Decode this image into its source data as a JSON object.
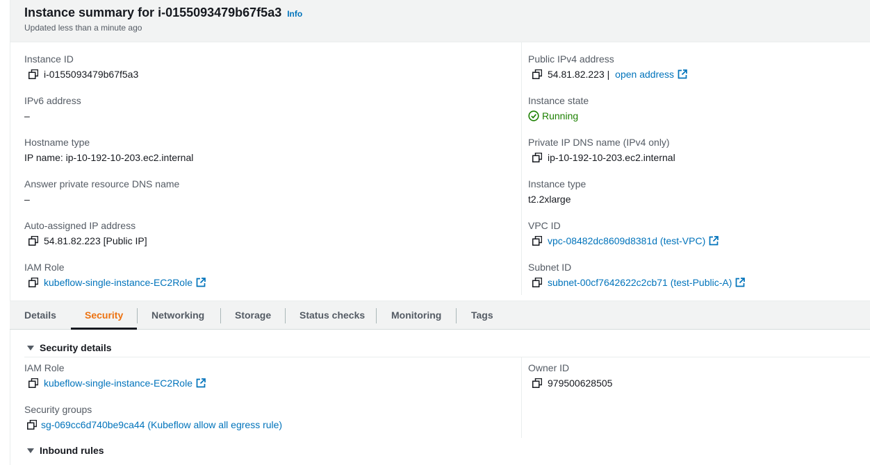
{
  "header": {
    "title": "Instance summary for i-0155093479b67f5a3",
    "info_label": "Info",
    "updated": "Updated less than a minute ago"
  },
  "summary": {
    "left": {
      "instance_id": {
        "label": "Instance ID",
        "value": "i-0155093479b67f5a3"
      },
      "ipv6": {
        "label": "IPv6 address",
        "value": "–"
      },
      "hostname_type": {
        "label": "Hostname type",
        "value": "IP name: ip-10-192-10-203.ec2.internal"
      },
      "answer_dns": {
        "label": "Answer private resource DNS name",
        "value": "–"
      },
      "auto_ip": {
        "label": "Auto-assigned IP address",
        "value": "54.81.82.223 [Public IP]"
      },
      "iam_role": {
        "label": "IAM Role",
        "value": "kubeflow-single-instance-EC2Role"
      }
    },
    "right": {
      "public_ipv4": {
        "label": "Public IPv4 address",
        "value": "54.81.82.223 | ",
        "link": "open address"
      },
      "state": {
        "label": "Instance state",
        "value": "Running"
      },
      "private_dns": {
        "label": "Private IP DNS name (IPv4 only)",
        "value": "ip-10-192-10-203.ec2.internal"
      },
      "type": {
        "label": "Instance type",
        "value": "t2.2xlarge"
      },
      "vpc": {
        "label": "VPC ID",
        "value": "vpc-08482dc8609d8381d (test-VPC)"
      },
      "subnet": {
        "label": "Subnet ID",
        "value": "subnet-00cf7642622c2cb71 (test-Public-A)"
      }
    }
  },
  "tabs": [
    "Details",
    "Security",
    "Networking",
    "Storage",
    "Status checks",
    "Monitoring",
    "Tags"
  ],
  "active_tab": "Security",
  "security": {
    "heading": "Security details",
    "iam_role": {
      "label": "IAM Role",
      "value": "kubeflow-single-instance-EC2Role"
    },
    "security_groups": {
      "label": "Security groups",
      "value": "sg-069cc6d740be9ca44 (Kubeflow allow all egress rule)"
    },
    "owner": {
      "label": "Owner ID",
      "value": "979500628505"
    },
    "inbound_heading": "Inbound rules"
  },
  "colors": {
    "link": "#0073bb",
    "running": "#1d8102",
    "active_tab": "#ec7211",
    "header_bg": "#f2f3f3"
  },
  "icons": [
    "copy-icon",
    "external-link-icon",
    "status-ok-icon",
    "caret-down-icon"
  ]
}
